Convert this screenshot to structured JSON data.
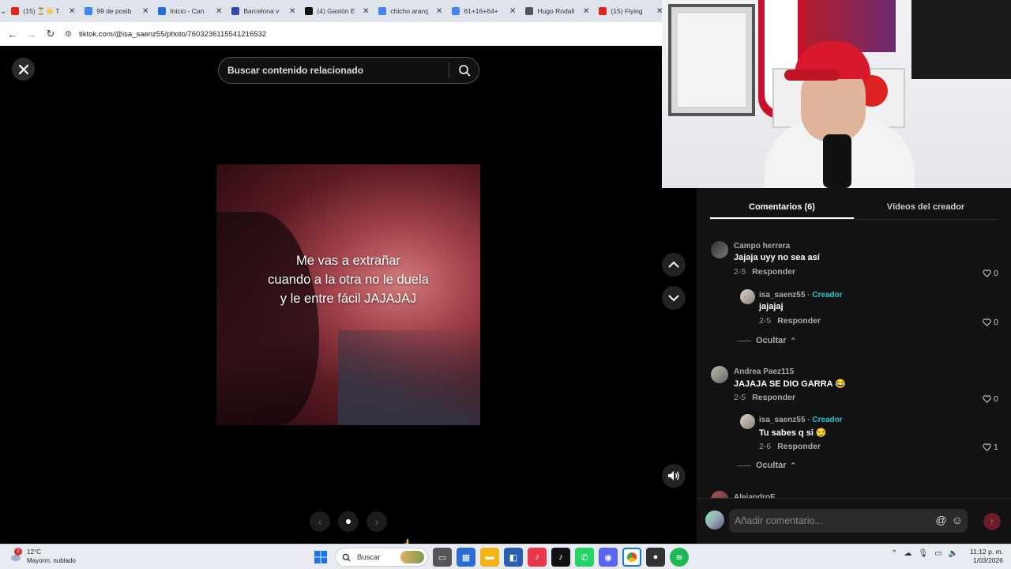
{
  "browser": {
    "tabs": [
      {
        "title": "(15) ⏳☀️ T",
        "favicon": "youtube-icon",
        "color": "#e62117"
      },
      {
        "title": "99 de posib",
        "favicon": "google-icon",
        "color": "#4285f4"
      },
      {
        "title": "Inicio - Can",
        "favicon": "canva-icon",
        "color": "#1e6fd9"
      },
      {
        "title": "Barcelona v",
        "favicon": "generic-icon",
        "color": "#3949ab"
      },
      {
        "title": "(4) Gastón E",
        "favicon": "x-icon",
        "color": "#111111"
      },
      {
        "title": "chicho aranç",
        "favicon": "google-icon",
        "color": "#4285f4"
      },
      {
        "title": "61+16+64+",
        "favicon": "google-icon",
        "color": "#4285f4"
      },
      {
        "title": "Hugo Rodall",
        "favicon": "wikipedia-icon",
        "color": "#555555"
      },
      {
        "title": "(15) Flying",
        "favicon": "youtube-icon",
        "color": "#e62117"
      }
    ],
    "url": "tiktok.com/@isa_saenz55/photo/7603236115541216532"
  },
  "viewer": {
    "search_placeholder": "Buscar contenido relacionado",
    "caption": [
      "Me vas a extrañar",
      "cuando a la otra no le duela",
      "y le entre fácil JAJAJAJ"
    ]
  },
  "comments_panel": {
    "tabs": {
      "comments": "Comentarios (6)",
      "creator_videos": "Vídeos del creador"
    },
    "comments": [
      {
        "user": "Campo herrera",
        "text": "Jajaja uyy no sea así",
        "date": "2-5",
        "reply": "Responder",
        "likes": "0"
      },
      {
        "user": "isa_saenz55",
        "creator_label": " · Creador",
        "text": "jajajaj",
        "date": "2-5",
        "reply": "Responder",
        "likes": "0"
      },
      {
        "user": "Andrea Paez115",
        "text": "JAJAJA SE DIO GARRA 😂",
        "date": "2-5",
        "reply": "Responder",
        "likes": "0"
      },
      {
        "user": "isa_saenz55",
        "creator_label": " · Creador",
        "text": "Tu sabes q si 😏",
        "date": "2-6",
        "reply": "Responder",
        "likes": "1"
      },
      {
        "user": "AlejandroF"
      }
    ],
    "hide_label": "Ocultar",
    "compose_placeholder": "Añadir comentario..."
  },
  "taskbar": {
    "weather_temp": "12°C",
    "weather_desc": "Mayorm. nublado",
    "weather_badge": "2",
    "search_label": "Buscar",
    "time": "11:12 p. m.",
    "date": "1/03/2026"
  }
}
